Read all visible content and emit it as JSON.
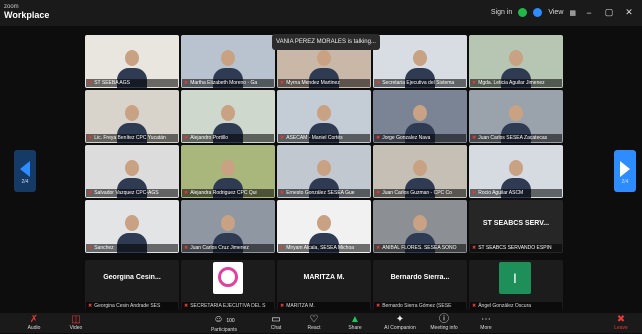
{
  "app": {
    "brand_top": "zoom",
    "brand_bottom": "Workplace"
  },
  "titlebar": {
    "signin": "Sign in",
    "view": "View",
    "minimize": "−",
    "restore": "▢",
    "close": "✕"
  },
  "speaking_banner": "VANIA PEREZ MORALES is talking...",
  "pager": {
    "left_page": "2/4",
    "right_page": "2/4"
  },
  "tiles": [
    {
      "name": "ST SEEBA AGS",
      "bg": "#e9e6df"
    },
    {
      "name": "Martha Elizabeth Moreno - Ga",
      "bg": "#b9c3cf"
    },
    {
      "name": "Myrna Mendez Martinez",
      "bg": "#c9b8a8"
    },
    {
      "name": "Secretaria Ejecutiva del Sistema",
      "bg": "#d8dde3"
    },
    {
      "name": "Mgda. Leticia Aguilar Jimenez",
      "bg": "#b7c6b2"
    },
    {
      "name": "Lic. Freya Benítez CPC Yucatán",
      "bg": "#d9d4cb"
    },
    {
      "name": "Alejandro Portillo",
      "bg": "#cfd8cc"
    },
    {
      "name": "ASECAM - Maniel Cortés",
      "bg": "#c4ccd6"
    },
    {
      "name": "Jorge Gonzalez Nava",
      "bg": "#7a8494"
    },
    {
      "name": "Juan Carlos SESEA Zacatecas",
      "bg": "#9aa3ab"
    },
    {
      "name": "Salvador Vazquez CPC-AGS",
      "bg": "#dcdcdc"
    },
    {
      "name": "Alejandra Rodriguez CPC Qui",
      "bg": "#a9b67c"
    },
    {
      "name": "Ernesto González SESEA Gue",
      "bg": "#c2c8cf"
    },
    {
      "name": "Juan Carlos Guzman - CPC Co",
      "bg": "#c5bfb5"
    },
    {
      "name": "Rocio Aguilar ASCM",
      "bg": "#d6dbe2"
    },
    {
      "name": "Sanchez",
      "bg": "#e2e4e6"
    },
    {
      "name": "Juan Carlos Cruz Jimenez",
      "bg": "#8f97a2"
    },
    {
      "name": "Miryam Alcala, SESEA Michoa",
      "bg": "#f1f1f1"
    },
    {
      "name": "ANIBAL FLORES. SESEA SONO",
      "bg": "#8c8f93"
    },
    {
      "name": "ST SEABCS SERVANDO ESPIN",
      "bg": "#262626",
      "text_label": "ST SEABCS SERV..."
    }
  ],
  "bottom_row": [
    {
      "display": "Georgina Cesin...",
      "name": "Georgina Cesin Andrade SES"
    },
    {
      "display": "",
      "name": "SECRETARIA EJECUTIVA DEL S"
    },
    {
      "display": "MARITZA M.",
      "name": "MARITZA M."
    },
    {
      "display": "Bernardo Sierra...",
      "name": "Bernardo Sierra Gómez (SESE"
    },
    {
      "display": "",
      "name": "Ángel González Oscura"
    }
  ],
  "toolbar": {
    "audio": "Audio",
    "video": "Video",
    "participants": "Participants",
    "participants_count": "100",
    "chat": "Chat",
    "react": "React",
    "share": "Share",
    "ai_companion": "AI Companion",
    "meeting_info": "Meeting info",
    "more": "More",
    "leave": "Leave"
  },
  "colors": {
    "accent": "#2d8cff",
    "muted_red": "#e53935",
    "signin_green": "#22b84a"
  }
}
